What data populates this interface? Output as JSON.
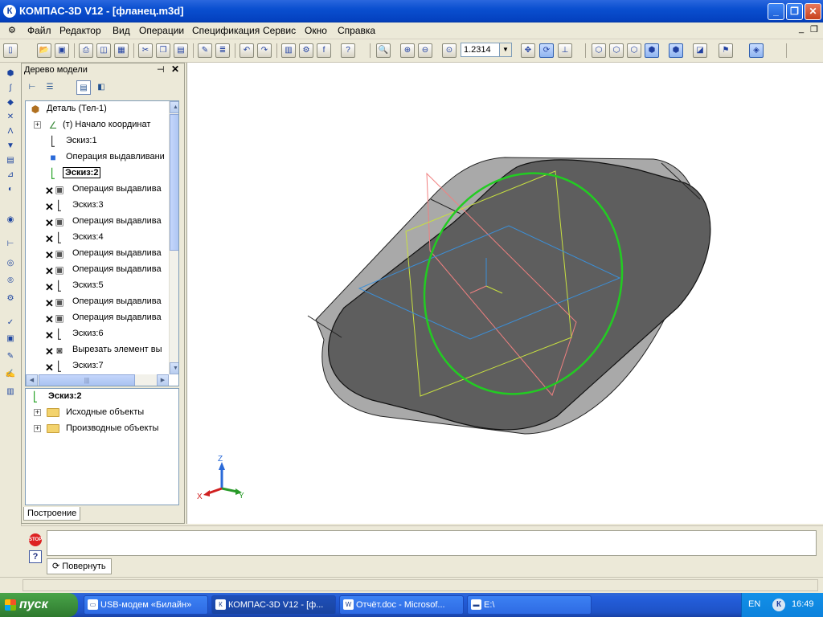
{
  "window": {
    "title": "КОМПАС-3D V12 - [фланец.m3d]",
    "icon": "kompas-logo-icon"
  },
  "menu": [
    "Файл",
    "Редактор",
    "Вид",
    "Операции",
    "Спецификация",
    "Сервис",
    "Окно",
    "Справка"
  ],
  "toolbar": {
    "zoom_value": "1.2314"
  },
  "tree_panel": {
    "title": "Дерево модели",
    "items": [
      {
        "label": "Деталь (Тел-1)",
        "icon": "part-icon"
      },
      {
        "label": "(т) Начало координат",
        "icon": "origin-icon"
      },
      {
        "label": "Эскиз:1",
        "icon": "sketch-icon"
      },
      {
        "label": "Операция выдавливани",
        "icon": "extrude-icon"
      },
      {
        "label": "Эскиз:2",
        "icon": "sketch-icon",
        "selected": true
      },
      {
        "label": "Операция выдавлива",
        "icon": "extrude-icon"
      },
      {
        "label": "Эскиз:3",
        "icon": "sketch-icon"
      },
      {
        "label": "Операция выдавлива",
        "icon": "extrude-icon"
      },
      {
        "label": "Эскиз:4",
        "icon": "sketch-icon"
      },
      {
        "label": "Операция выдавлива",
        "icon": "extrude-icon"
      },
      {
        "label": "Операция выдавлива",
        "icon": "extrude-icon"
      },
      {
        "label": "Эскиз:5",
        "icon": "sketch-icon"
      },
      {
        "label": "Операция выдавлива",
        "icon": "extrude-icon"
      },
      {
        "label": "Операция выдавлива",
        "icon": "extrude-icon"
      },
      {
        "label": "Эскиз:6",
        "icon": "sketch-icon"
      },
      {
        "label": "Вырезать элемент вы",
        "icon": "cut-icon"
      },
      {
        "label": "Эскиз:7",
        "icon": "sketch-icon"
      }
    ],
    "properties": {
      "title": "Эскиз:2",
      "items": [
        "Исходные объекты",
        "Производные объекты"
      ]
    },
    "tab": "Построение"
  },
  "viewport": {
    "axes": {
      "z": "Z",
      "x": "X",
      "y": "Y"
    },
    "colors": {
      "background": "#ffffff",
      "body": "#5e5e5e",
      "side": "#a8a8a8",
      "sketch_circle": "#22cc22",
      "plane_xy": "#3b8fd8",
      "plane_yz": "#c8e040",
      "plane_xz": "#f08080"
    }
  },
  "bottom": {
    "rotate_label": "Повернуть"
  },
  "taskbar": {
    "start": "пуск",
    "tasks": [
      {
        "label": "USB-модем «Билайн»",
        "icon": "modem-icon"
      },
      {
        "label": "КОМПАС-3D V12 - [ф...",
        "icon": "kompas-icon",
        "active": true
      },
      {
        "label": "Отчёт.doc - Microsof...",
        "icon": "word-icon"
      },
      {
        "label": "E:\\",
        "icon": "drive-icon"
      }
    ],
    "lang": "EN",
    "clock": "16:49"
  }
}
